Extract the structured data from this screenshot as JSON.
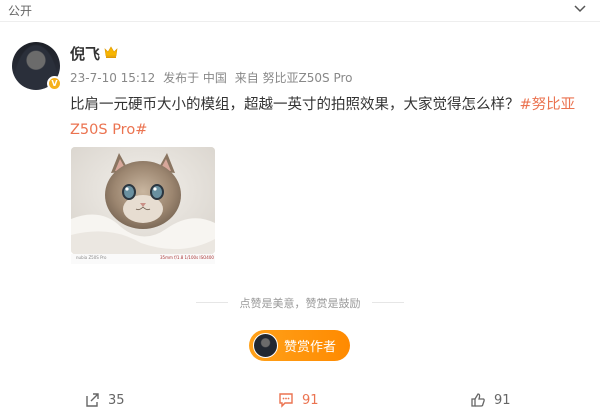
{
  "header": {
    "visibility": "公开"
  },
  "post": {
    "username": "倪飞",
    "time": "23-7-10 15:12",
    "published_in": "发布于 中国",
    "source": "来自 努比亚Z50S Pro",
    "text": "比肩一元硬币大小的模组，超越一英寸的拍照效果，大家觉得怎么样？",
    "hashtag": "#努比亚Z50S Pro#",
    "photo_brand": "nubia Z50S Pro",
    "photo_spec": "35mm f/1.8 1/100s ISO400"
  },
  "reward": {
    "divider": "点赞是美意，赞赏是鼓励",
    "button": "赞赏作者"
  },
  "actions": {
    "share_count": "35",
    "comment_count": "91",
    "like_count": "91"
  },
  "colors": {
    "accent": "#eb7350",
    "reward_button": "#ff9a0e",
    "verified_badge": "#f6b11d"
  }
}
